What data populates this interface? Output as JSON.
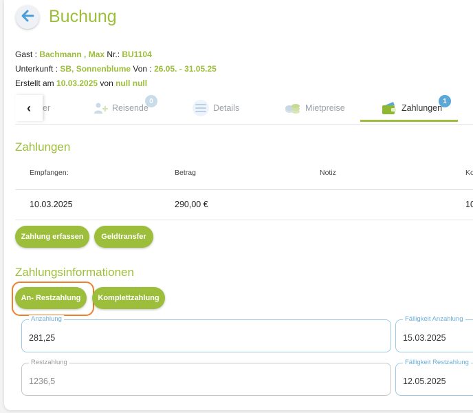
{
  "header": {
    "title": "Buchung"
  },
  "booking_info": {
    "guest_label": "Gast : ",
    "guest_name": "Bachmann , Max",
    "nr_label": " Nr.: ",
    "nr_value": "BU1104",
    "unterkunft_label": "Unterkunft : ",
    "unterkunft_value": "SB, Sonnenblume",
    "von_label": " Von : ",
    "date_range": "26.05. - 31.05.25",
    "erstellt_label": "Erstellt am ",
    "erstellt_date": "10.03.2025",
    "von2_label": " von ",
    "creator": "null null"
  },
  "tabs": {
    "prev_arrow": "‹",
    "partial_label": "er",
    "items": [
      {
        "label": "Reisende",
        "badge": "0",
        "icon": "people-icon"
      },
      {
        "label": "Details",
        "icon": "list-icon"
      },
      {
        "label": "Mietpreise",
        "icon": "coins-icon"
      },
      {
        "label": "Zahlungen",
        "badge": "1",
        "icon": "wallet-icon",
        "active": true
      }
    ]
  },
  "payments": {
    "title": "Zahlungen",
    "columns": [
      "Empfangen:",
      "Betrag",
      "Notiz",
      "Ko"
    ],
    "rows": [
      {
        "empfangen": "10.03.2025",
        "betrag": "290,00 €",
        "notiz": "",
        "ko": "10"
      }
    ],
    "buttons": {
      "zahlung_erfassen": "Zahlung erfassen",
      "geldtransfer": "Geldtransfer"
    }
  },
  "payment_info": {
    "title": "Zahlungsinformationen",
    "buttons": {
      "an_restzahlung": "An- Restzahlung",
      "komplettzahlung": "Komplettzahlung"
    },
    "fields": {
      "anzahlung": {
        "label": "Anzahlung",
        "value": "281,25"
      },
      "faelligkeit_anzahlung": {
        "label": "Fälligkeit Anzahlung",
        "value": "15.03.2025"
      },
      "restzahlung": {
        "label": "Restzahlung",
        "value": "1236,5"
      },
      "faelligkeit_restzahlung": {
        "label": "Fälligkeit Restzahlung",
        "value": "12.05.2025"
      }
    }
  },
  "colors": {
    "accent_green": "#9cbe3a",
    "field_border_blue": "#9ccbe6",
    "highlight_orange": "#f07f2c",
    "badge_blue": "#5aa7d8"
  }
}
